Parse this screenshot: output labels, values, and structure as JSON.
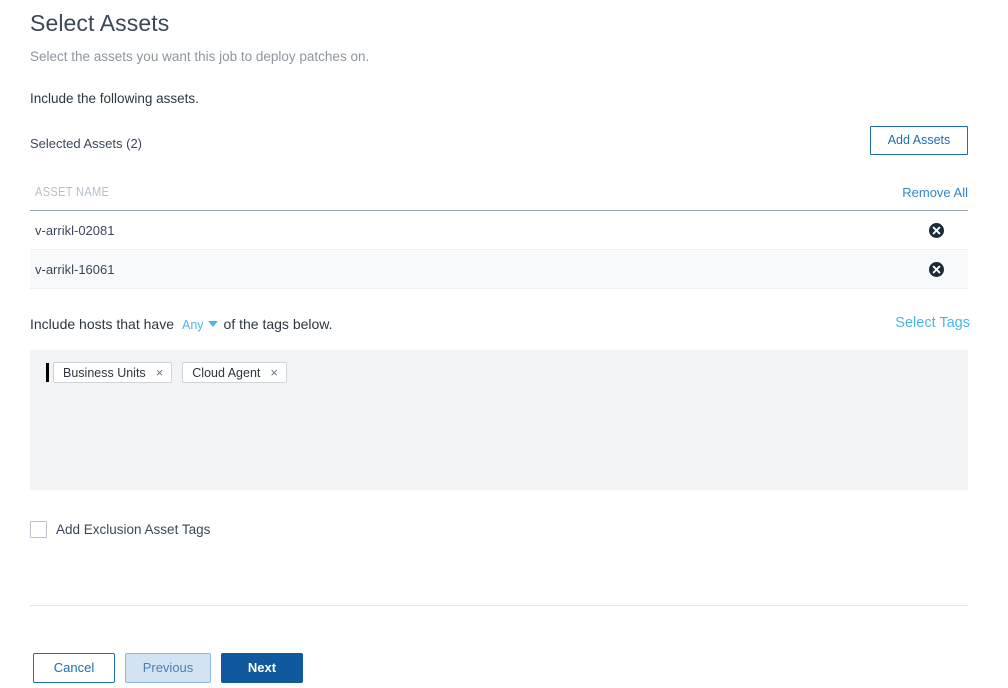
{
  "header": {
    "title": "Select Assets",
    "subtitle": "Select the assets you want this job to deploy patches on.",
    "section_label": "Include the following assets."
  },
  "assets": {
    "selected_count_label": "Selected Assets (2)",
    "add_assets_label": "Add Assets",
    "column_header": "ASSET NAME",
    "remove_all_label": "Remove All",
    "rows": [
      {
        "name": "v-arrikl-02081",
        "remove_icon": "remove-circle-icon"
      },
      {
        "name": "v-arrikl-16061",
        "remove_icon": "remove-circle-icon"
      }
    ]
  },
  "tags": {
    "sentence_prefix": "Include hosts that have",
    "match_mode": "Any",
    "sentence_suffix": "of the tags below.",
    "select_tags_label": "Select Tags",
    "chips": [
      {
        "label": "Business Units",
        "close": "×"
      },
      {
        "label": "Cloud Agent",
        "close": "×"
      }
    ]
  },
  "exclusion": {
    "label": "Add Exclusion Asset Tags",
    "checked": false
  },
  "footer": {
    "cancel_label": "Cancel",
    "previous_label": "Previous",
    "next_label": "Next"
  },
  "colors": {
    "primary_blue": "#10599f",
    "link_blue": "#3387cc",
    "light_blue": "#4cb6ec",
    "outline_blue": "#1f6cb5",
    "panel_gray": "#f2f3f4",
    "row_alt_gray": "#f7f9fa",
    "header_gray": "#b3bfcb"
  }
}
